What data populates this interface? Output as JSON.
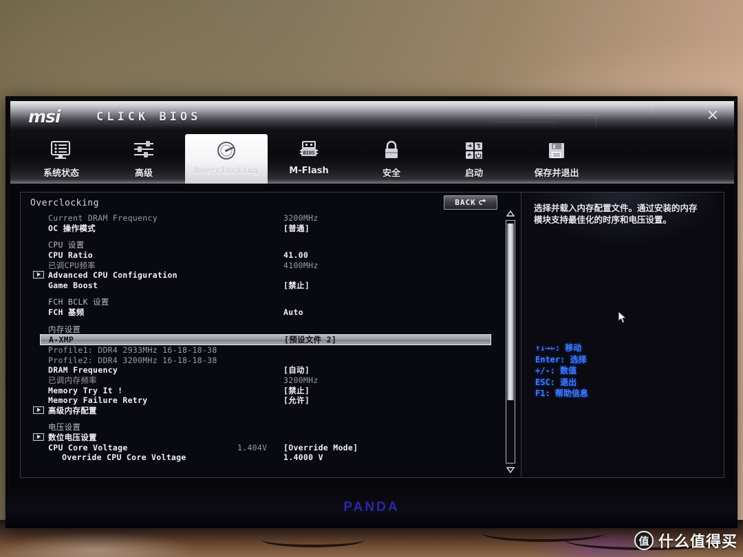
{
  "header": {
    "brand": "msi",
    "product": "CLICK BIOS",
    "close_icon": "close-icon"
  },
  "nav": {
    "tabs": [
      {
        "label": "系统状态",
        "icon": "monitor-icon",
        "active": false
      },
      {
        "label": "高级",
        "icon": "sliders-icon",
        "active": false
      },
      {
        "label": "Overclocking",
        "icon": "gauge-icon",
        "active": true
      },
      {
        "label": "M-Flash",
        "icon": "usb-bios-icon",
        "active": false
      },
      {
        "label": "安全",
        "icon": "lock-icon",
        "active": false
      },
      {
        "label": "启动",
        "icon": "boot-grid-icon",
        "active": false
      },
      {
        "label": "保存并退出",
        "icon": "floppy-save-icon",
        "active": false
      }
    ]
  },
  "main": {
    "section_title": "Overclocking",
    "back_label": "BACK",
    "back_icon": "back-arrow-icon",
    "rows": [
      {
        "type": "item",
        "label": "Current DRAM Frequency",
        "value": "3200MHz",
        "style": "dim"
      },
      {
        "type": "item",
        "label": "OC 操作模式",
        "value": "[普通]",
        "style": "white"
      },
      {
        "type": "gap"
      },
      {
        "type": "group",
        "label": "CPU 设置",
        "value": ""
      },
      {
        "type": "item",
        "label": "CPU Ratio",
        "value": "41.00",
        "style": "white"
      },
      {
        "type": "item",
        "label": "已调CPU频率",
        "value": "4100MHz",
        "style": "dim"
      },
      {
        "type": "sub",
        "label": "Advanced CPU Configuration",
        "value": "",
        "style": "white"
      },
      {
        "type": "item",
        "label": "Game Boost",
        "value": "[禁止]",
        "style": "white"
      },
      {
        "type": "gap"
      },
      {
        "type": "group",
        "label": "FCH BCLK 设置",
        "value": ""
      },
      {
        "type": "item",
        "label": "FCH 基频",
        "value": "Auto",
        "style": "white"
      },
      {
        "type": "gap"
      },
      {
        "type": "group",
        "label": "内存设置",
        "value": ""
      },
      {
        "type": "selected",
        "label": "A-XMP",
        "value": "[预设文件 2]"
      },
      {
        "type": "item",
        "label": "Profile1: DDR4 2933MHz 16-18-18-38",
        "value": "",
        "style": "dim"
      },
      {
        "type": "item",
        "label": "Profile2: DDR4 3200MHz 16-18-18-38",
        "value": "",
        "style": "dim"
      },
      {
        "type": "item",
        "label": "DRAM Frequency",
        "value": "[自动]",
        "style": "white"
      },
      {
        "type": "item",
        "label": "已调内存频率",
        "value": "3200MHz",
        "style": "dim"
      },
      {
        "type": "item",
        "label": "Memory Try It !",
        "value": "[禁止]",
        "style": "white"
      },
      {
        "type": "item",
        "label": "Memory Failure Retry",
        "value": "[允许]",
        "style": "white"
      },
      {
        "type": "sub",
        "label": "高级内存配置",
        "value": "",
        "style": "white"
      },
      {
        "type": "gap"
      },
      {
        "type": "group",
        "label": "电压设置",
        "value": ""
      },
      {
        "type": "sub",
        "label": "数位电压设置",
        "value": "",
        "style": "white"
      },
      {
        "type": "item",
        "label": "CPU Core Voltage",
        "value": "[Override Mode]",
        "value2": "1.404V",
        "style": "white"
      },
      {
        "type": "indent",
        "label": "Override CPU Core Voltage",
        "value": "1.4000 V",
        "style": "white"
      }
    ]
  },
  "help": {
    "description": "选择并载入内存配置文件。通过安装的内存模块支持最佳化的时序和电压设置。",
    "legend": [
      "↑↓→←: 移动",
      "Enter: 选择",
      "+/-: 数值",
      "ESC: 退出",
      "F1: 帮助信息"
    ],
    "cursor_icon": "mouse-pointer-icon"
  },
  "monitor": {
    "brand": "PANDA"
  },
  "watermark": {
    "badge": "值",
    "text": "什么值得买"
  },
  "colors": {
    "legend_blue": "#3b7bff",
    "screen_bg": "#08080c",
    "highlight": "#9c9ca6"
  }
}
